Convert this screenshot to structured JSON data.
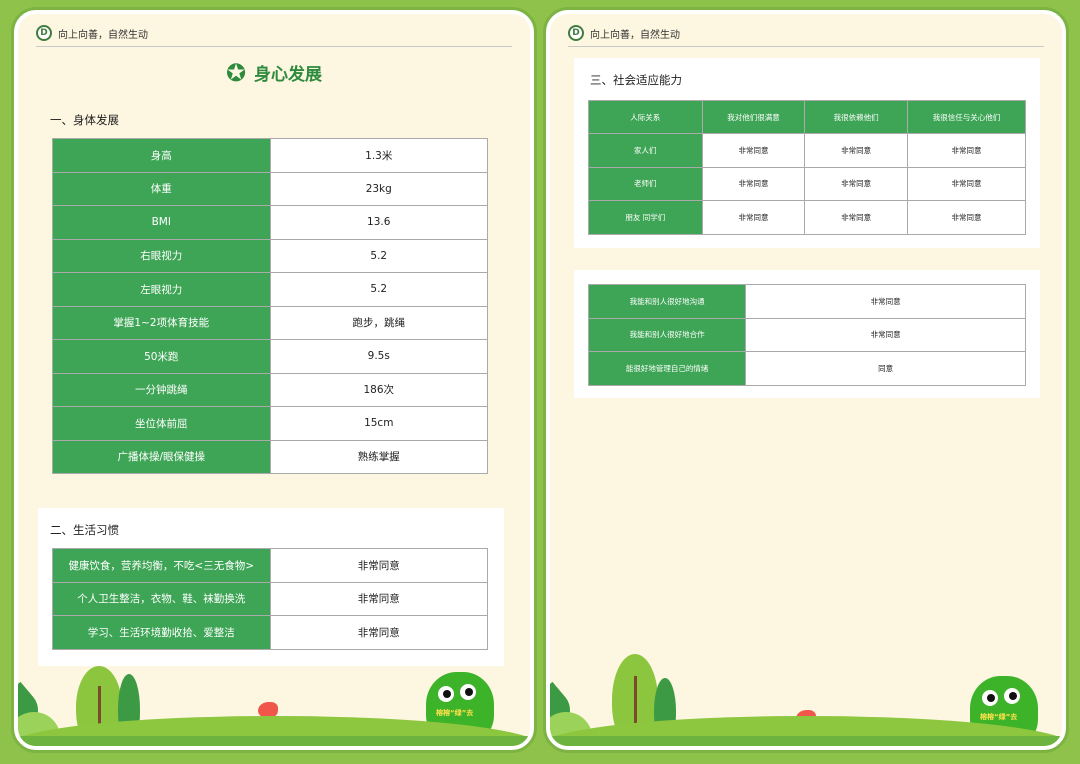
{
  "brand": {
    "logo_letter": "D",
    "slogan": "向上向善，自然生动"
  },
  "left_page": {
    "title": "身心发展",
    "section1": {
      "title": "一、身体发展",
      "rows": [
        {
          "label": "身高",
          "value": "1.3米"
        },
        {
          "label": "体重",
          "value": "23kg"
        },
        {
          "label": "BMI",
          "value": "13.6"
        },
        {
          "label": "右眼视力",
          "value": "5.2"
        },
        {
          "label": "左眼视力",
          "value": "5.2"
        },
        {
          "label": "掌握1~2项体育技能",
          "value": "跑步，跳绳"
        },
        {
          "label": "50米跑",
          "value": "9.5s"
        },
        {
          "label": "一分钟跳绳",
          "value": "186次"
        },
        {
          "label": "坐位体前屈",
          "value": "15cm"
        },
        {
          "label": "广播体操/眼保健操",
          "value": "熟练掌握"
        }
      ]
    },
    "section2": {
      "title": "二、生活习惯",
      "rows": [
        {
          "label": "健康饮食，营养均衡，不吃<三无食物>",
          "value": "非常同意"
        },
        {
          "label": "个人卫生整洁，衣物、鞋、袜勤换洗",
          "value": "非常同意"
        },
        {
          "label": "学习、生活环境勤收拾、爱整洁",
          "value": "非常同意"
        }
      ]
    }
  },
  "right_page": {
    "section3": {
      "title": "三、社会适应能力",
      "headers": [
        "人际关系",
        "我对他们很满意",
        "我很依赖他们",
        "我很信任与关心他们"
      ],
      "rows": [
        {
          "label": "家人们",
          "cells": [
            "非常同意",
            "非常同意",
            "非常同意"
          ]
        },
        {
          "label": "老师们",
          "cells": [
            "非常同意",
            "非常同意",
            "非常同意"
          ]
        },
        {
          "label": "朋友  同学们",
          "cells": [
            "非常同意",
            "非常同意",
            "非常同意"
          ]
        }
      ]
    },
    "section4": {
      "rows": [
        {
          "label": "我能和别人很好地沟通",
          "value": "非常同意"
        },
        {
          "label": "我能和别人很好地合作",
          "value": "非常同意"
        },
        {
          "label": "能很好地管理自己的情绪",
          "value": "同意"
        }
      ]
    }
  },
  "mascot": {
    "text": "榕榕“绿”去"
  },
  "colors": {
    "label_green": "#3ea556",
    "page_bg": "#fdf6e0",
    "frame_green": "#8fc24a"
  }
}
